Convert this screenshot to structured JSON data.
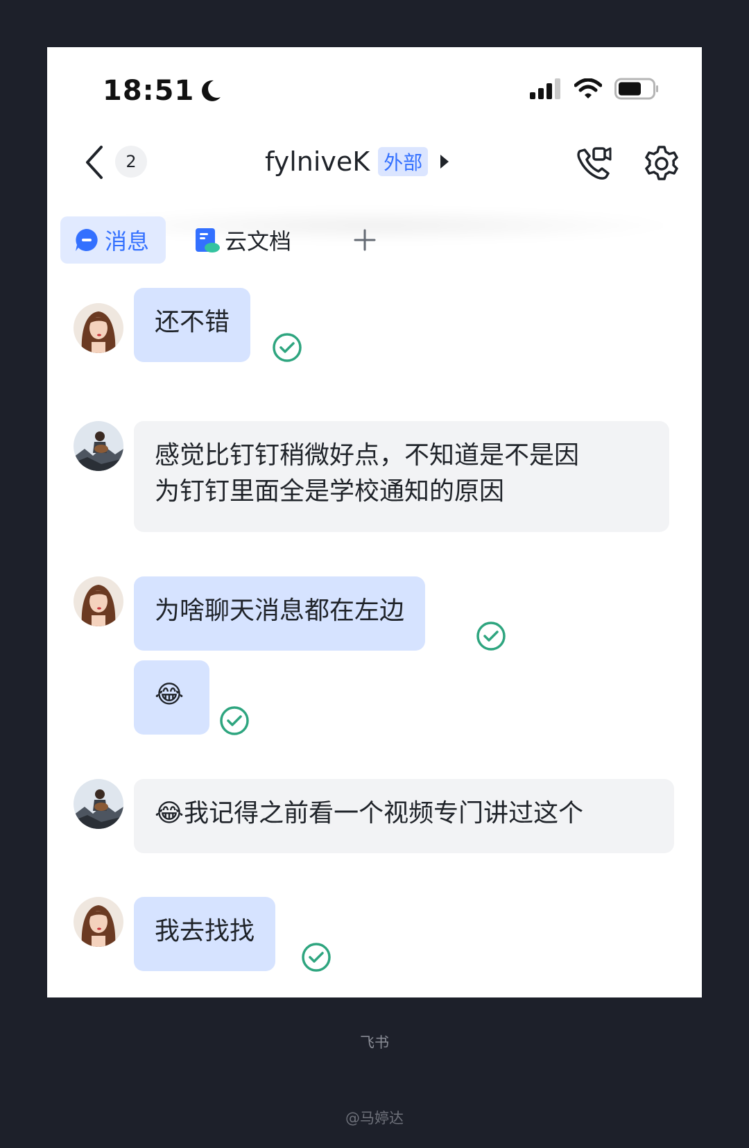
{
  "status_bar": {
    "time": "18:51",
    "icons": [
      "moon-icon",
      "signal-icon",
      "wifi-icon",
      "battery-icon"
    ]
  },
  "header": {
    "back_icon": "chevron-left-icon",
    "unread_count": "2",
    "title": "fylniveK",
    "external_tag": "外部",
    "call_icon": "video-call-icon",
    "settings_icon": "gear-icon"
  },
  "tabs": {
    "messages": "消息",
    "docs": "云文档",
    "add_icon": "plus-icon"
  },
  "messages": [
    {
      "sender": "me",
      "text": "还不错",
      "read": true
    },
    {
      "sender": "them",
      "text_line1": "感觉比钉钉稍微好点，不知道是不是因",
      "text_line2": "为钉钉里面全是学校通知的原因"
    },
    {
      "sender": "me",
      "text": "为啥聊天消息都在左边",
      "read": true
    },
    {
      "sender": "me",
      "emoji": "😂",
      "read": true
    },
    {
      "sender": "them",
      "emoji": "😂",
      "text": "我记得之前看一个视频专门讲过这个"
    },
    {
      "sender": "me",
      "text": "我去找找",
      "read": true
    }
  ],
  "footer": {
    "app_name": "飞书",
    "author": "@马婷达"
  },
  "colors": {
    "accent": "#3370ff",
    "my_bubble": "#d6e3ff",
    "their_bubble": "#f2f3f5",
    "read_check": "#2ea57f",
    "page_bg": "#1d202a"
  }
}
